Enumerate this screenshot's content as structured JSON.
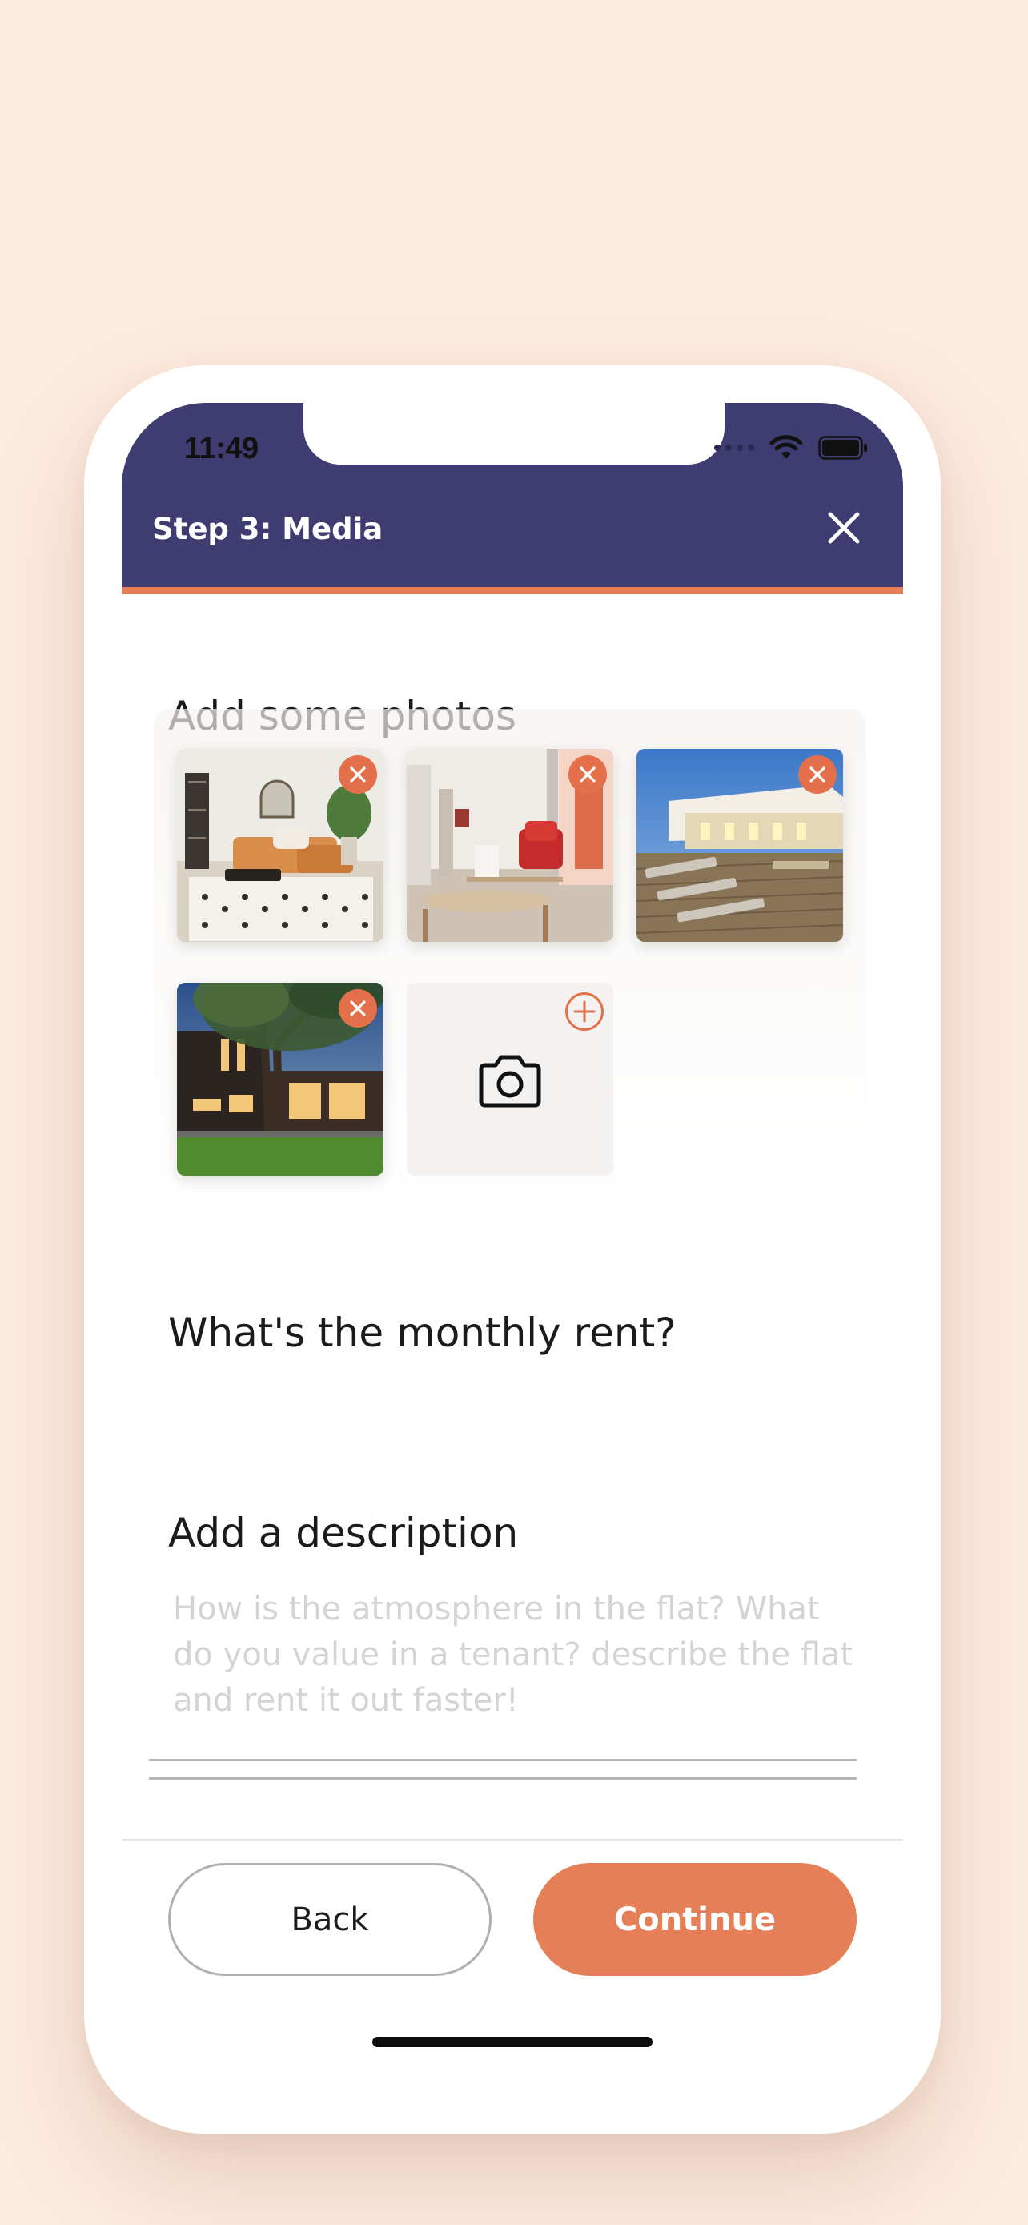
{
  "status_bar": {
    "time": "11:49"
  },
  "header": {
    "title": "Step 3: Media"
  },
  "photos": {
    "title": "Add some photos",
    "items": [
      {
        "name": "living-room-photo"
      },
      {
        "name": "red-armchair-room-photo"
      },
      {
        "name": "terrace-photo"
      },
      {
        "name": "modern-house-photo"
      }
    ]
  },
  "rent": {
    "title": "What's the monthly rent?",
    "value": ""
  },
  "description": {
    "title": "Add a description",
    "placeholder": "How is the atmosphere in the flat? What do you value in a tenant? describe the flat and rent it out faster!",
    "value": ""
  },
  "footer": {
    "back_label": "Back",
    "continue_label": "Continue"
  },
  "colors": {
    "header": "#3f3c71",
    "accent": "#e57f57",
    "background": "#fdebdf"
  }
}
